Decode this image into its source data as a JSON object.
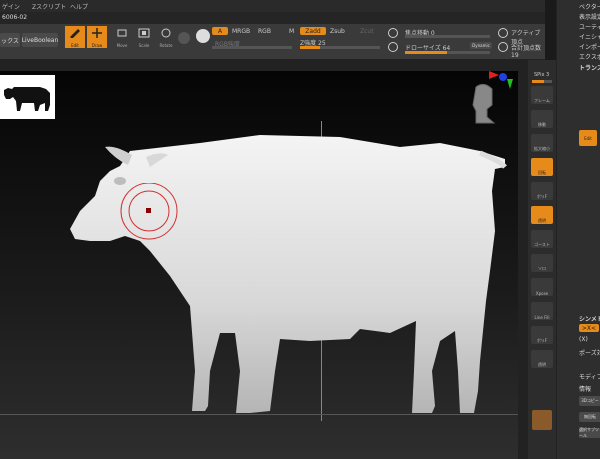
{
  "menubar": {
    "items": [
      "ゲイン",
      "Zスクリプト",
      "ヘルプ"
    ]
  },
  "document": {
    "title": "6006-02"
  },
  "toolbar": {
    "left_buttons": [
      "ックス",
      "LiveBoolean"
    ],
    "mode_buttons": [
      "Edit",
      "Draw",
      "Move",
      "Scale",
      "Rotate"
    ],
    "a_label": "A",
    "mrgb": "MRGB",
    "rgb": "RGB",
    "m": "M",
    "zadd": "Zadd",
    "zsub": "Zsub",
    "zcut": "Zcut",
    "rgb_intensity": "RGB強度",
    "z_intensity": "Z強度 25",
    "z_intensity_value": 25,
    "focal_shift": "焦点移動 0",
    "draw_size": "ドローサイズ 64",
    "dynamic": "Dynamic",
    "active_points": "アクティブ頂点",
    "total_points": "合計頂点数 19"
  },
  "shelf": {
    "spix": "SPix 3",
    "items": [
      "フレーム",
      "移動",
      "拡大縮小",
      "回転",
      "ポリF",
      "透明",
      "ゴースト",
      "ソロ",
      "Xpose",
      "Line Fill",
      "ポリF",
      "透明"
    ]
  },
  "right_panel": {
    "items": [
      "ベクター",
      "表示設定",
      "ユーティリティ",
      "イニシャライズ",
      "インポート",
      "エクスポート",
      "トランスフォーム",
      "Edit",
      "シンメトリー",
      "(X)",
      "ポーズ対称",
      "モディファイ",
      "情報",
      "3Dコピー",
      "無回転",
      "選択サブツール"
    ],
    "symmetry_value": ">X<"
  },
  "colors": {
    "accent": "#e68a1a",
    "brush_ring": "#d32f2f"
  }
}
